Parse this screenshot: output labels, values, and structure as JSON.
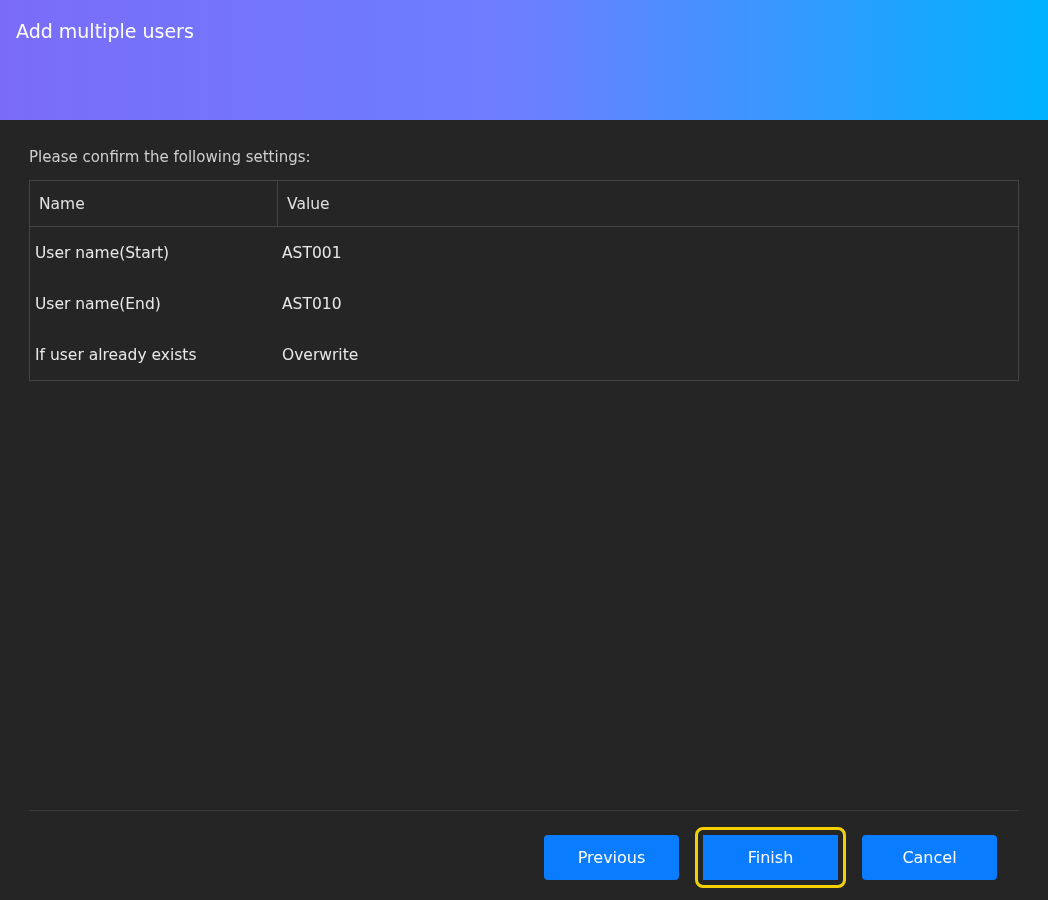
{
  "dialog": {
    "title": "Add multiple users"
  },
  "prompt": "Please confirm the following settings:",
  "table": {
    "columns": [
      "Name",
      "Value"
    ],
    "rows": [
      {
        "name": "User name(Start)",
        "value": "AST001"
      },
      {
        "name": "User name(End)",
        "value": "AST010"
      },
      {
        "name": "If user already exists",
        "value": "Overwrite"
      }
    ]
  },
  "buttons": [
    {
      "label": "Previous",
      "focused": false
    },
    {
      "label": "Finish",
      "focused": true
    },
    {
      "label": "Cancel",
      "focused": false
    }
  ]
}
